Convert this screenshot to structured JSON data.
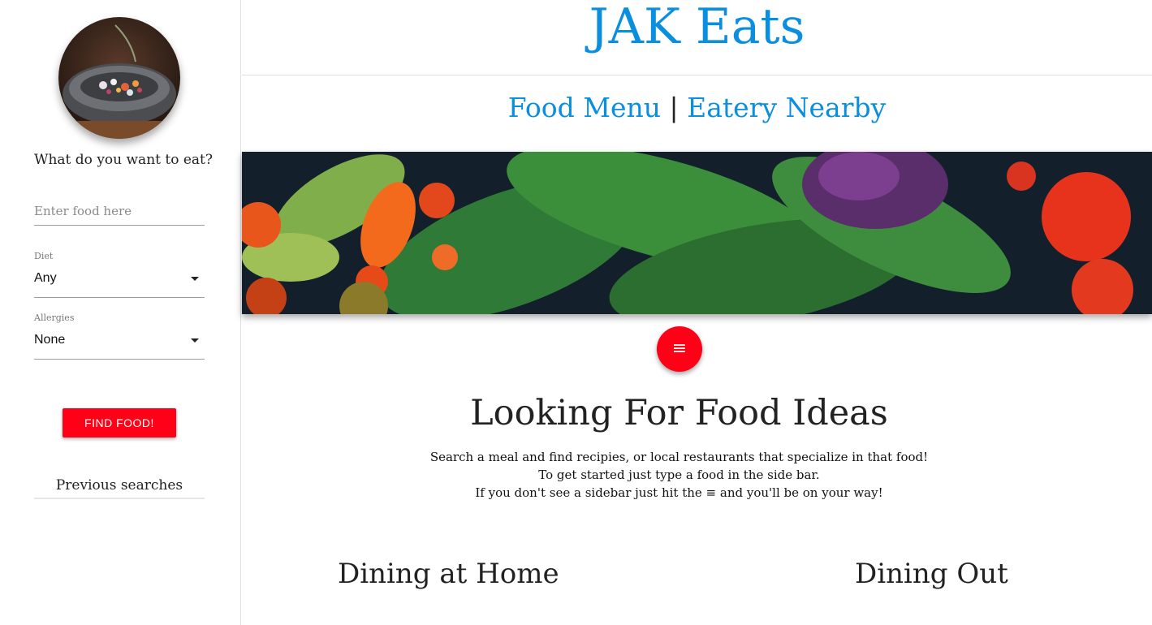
{
  "sidebar": {
    "prompt": "What do you want to eat?",
    "food_input": {
      "placeholder": "Enter food here",
      "value": ""
    },
    "diet": {
      "label": "Diet",
      "value": "Any"
    },
    "allergies": {
      "label": "Allergies",
      "value": "None"
    },
    "find_button": "FIND FOOD!",
    "previous_searches_title": "Previous searches"
  },
  "header": {
    "title": "JAK Eats",
    "nav": {
      "food_menu": "Food Menu",
      "separator": "|",
      "eatery_nearby": "Eatery Nearby"
    }
  },
  "main": {
    "menu_icon": "≡",
    "heading": "Looking For Food Ideas",
    "intro_lines": [
      "Search a meal and find recipies, or local restaurants that specialize in that food!",
      "To get started just type a food in the side bar.",
      "If you don't see a sidebar just hit the ≡ and you'll be on your way!"
    ],
    "dining_home": "Dining at Home",
    "dining_out": "Dining Out"
  },
  "colors": {
    "accent_blue": "#0a8fe0",
    "accent_red": "#ff0016"
  },
  "icons": {
    "menu": "hamburger-menu-icon",
    "dropdown": "caret-down-icon"
  }
}
